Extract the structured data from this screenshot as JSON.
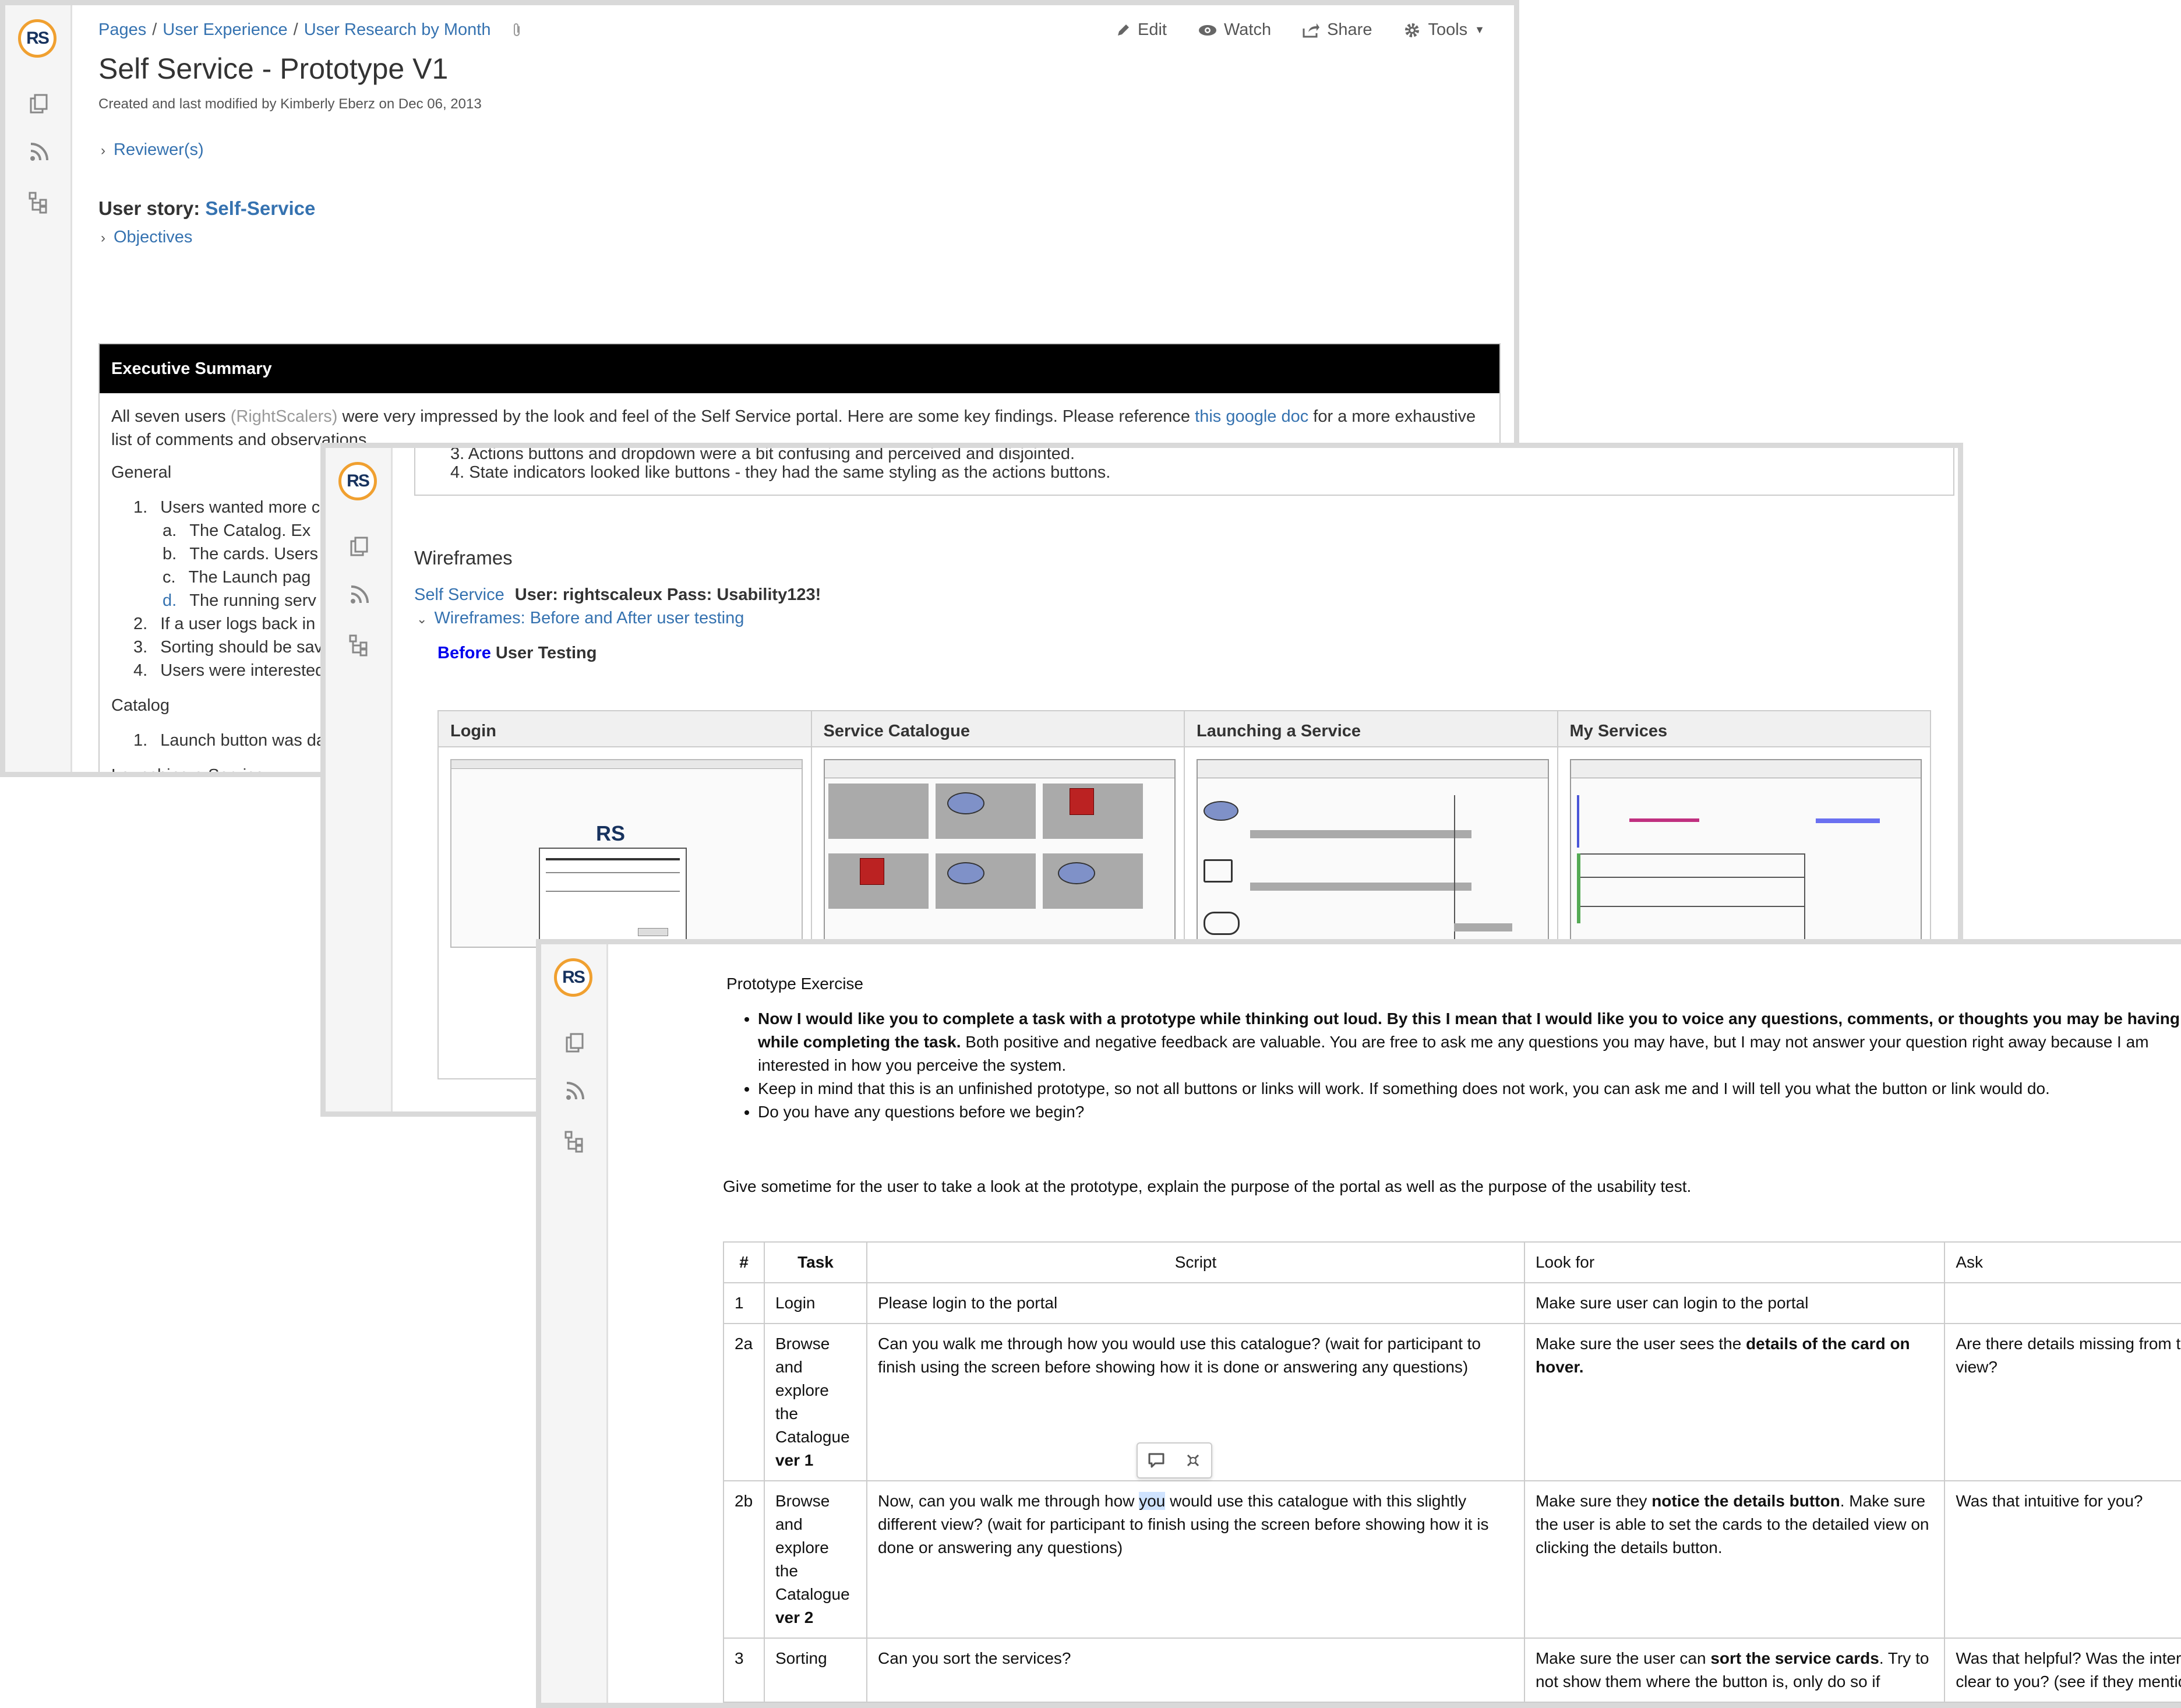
{
  "brand": {
    "logo": "RS",
    "accent": "#f0a030",
    "navy": "#17325e",
    "link_color": "#3572b0"
  },
  "sidebar_icons": [
    "pages-icon",
    "rss-icon",
    "tree-icon"
  ],
  "panel1": {
    "breadcrumb": [
      "Pages",
      "User Experience",
      "User Research by Month"
    ],
    "actions": {
      "edit": "Edit",
      "watch": "Watch",
      "share": "Share",
      "tools": "Tools"
    },
    "title": "Self Service - Prototype V1",
    "meta": "Created and last modified by Kimberly Eberz on Dec 06, 2013",
    "reviewers": "Reviewer(s)",
    "user_story_label": "User story:",
    "user_story_link": "Self-Service",
    "objectives": "Objectives",
    "exec_heading": "Executive Summary",
    "exec_intro_a": "All seven users",
    "exec_intro_b": "(RightScalers)",
    "exec_intro_c": "were very impressed by the look and feel of the Self Service portal. Here are some key findings. Please reference",
    "exec_intro_link": "this google doc",
    "exec_intro_d": "for a more exhaustive list of comments and observations.",
    "general": "General",
    "general_items": [
      {
        "num": "1.",
        "text": "Users wanted more co"
      },
      {
        "num": "a.",
        "text": "The Catalog. Ex"
      },
      {
        "num": "b.",
        "text": "The cards. Users"
      },
      {
        "num": "c.",
        "text": "The Launch pag"
      },
      {
        "num": "d.",
        "text": "The running serv"
      },
      {
        "num": "2.",
        "text": "If a user logs back in a"
      },
      {
        "num": "3.",
        "text": "Sorting should be save"
      },
      {
        "num": "4.",
        "text": "Users were interested"
      }
    ],
    "catalog": "Catalog",
    "catalog_items": [
      {
        "num": "1.",
        "text": "Launch button was dau"
      }
    ],
    "launching": "Launching a Service:"
  },
  "panel2": {
    "prev_line_3": "3.  Actions buttons and dropdown were a bit confusing and perceived and disjointed.",
    "prev_line_4": "4.  State indicators looked like buttons - they had the same styling as the actions buttons.",
    "wireframes": "Wireframes",
    "self_service_link": "Self Service",
    "credentials": "User: rightscaleux Pass: Usability123!",
    "wf_expander": "Wireframes: Before and After user testing",
    "before": "Before",
    "user_testing": "User Testing",
    "columns": [
      "Login",
      "Service Catalogue",
      "Launching a Service",
      "My Services"
    ]
  },
  "panel3": {
    "heading": "Prototype Exercise",
    "bullet1_bold": "Now I would like you to complete a task with a prototype while thinking out loud. By this I mean that I would like you to voice any questions, comments, or thoughts you may be having while completing the task.",
    "bullet1_rest": "Both positive and negative feedback are valuable. You are free to ask me any questions you may have, but I may not answer your question right away because I am interested in how you perceive the system.",
    "bullet2": "Keep in mind that this is an unfinished prototype, so not all buttons or links will work. If something does not work, you can ask me and I will tell you what the button or link would do.",
    "bullet3": "Do you have any questions before we begin?",
    "instruction": "Give sometime for the user to take a look at the prototype, explain the purpose of the portal as well as the purpose of the usability test.",
    "table_headers": {
      "num": "#",
      "task": "Task",
      "script": "Script",
      "look": "Look for",
      "ask": "Ask"
    },
    "rows": [
      {
        "num": "1",
        "task": "Login",
        "task_bold": "",
        "script": "Please login to the portal",
        "look_a": "Make sure user can login to the portal",
        "look_b": "",
        "look_c": "",
        "ask": ""
      },
      {
        "num": "2a",
        "task": "Browse and explore the Catalogue",
        "task_bold": "ver 1",
        "script": "Can you walk me through how you would use this catalogue? (wait for participant to finish using the screen before showing how it is done or answering any questions)",
        "look_a": "Make sure the user sees the",
        "look_b": "details of the card on hover.",
        "look_c": "",
        "ask": "Are there details missing from the cards in view?"
      },
      {
        "num": "2b",
        "task": "Browse and explore the Catalogue",
        "task_bold": "ver 2",
        "script_a": "Now, can you walk me through how",
        "script_hl": "you",
        "script_b": "would use this catalogue with this slightly different view? (wait for participant to finish using the screen before showing how it is done or answering any questions)",
        "look_a": "Make sure they",
        "look_b": "notice the details button",
        "look_c": ". Make sure the user is able to set the cards to the detailed view on clicking the details button.",
        "ask": "Was that intuitive for you?"
      },
      {
        "num": "3",
        "task": "Sorting",
        "task_bold": "",
        "script": "Can you sort the services?",
        "look_a": "Make sure the user can",
        "look_b": "sort the service cards",
        "look_c": ". Try to not show them where the button is, only do so if",
        "ask": "Was that helpful? Was the interaction clear to you? (see if they mention the"
      }
    ]
  }
}
